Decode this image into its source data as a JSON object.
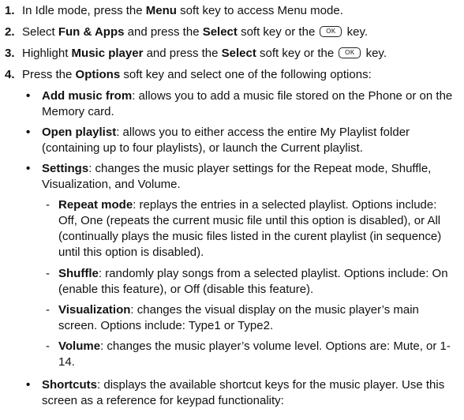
{
  "ok_key_label": "OK",
  "steps": [
    {
      "num": "1.",
      "pre": "In Idle mode, press the ",
      "b1": "Menu",
      "post": " soft key to access Menu mode."
    },
    {
      "num": "2.",
      "pre": "Select ",
      "b1": "Fun & Apps",
      "mid": " and press the ",
      "b2": "Select",
      "post": " soft key or the",
      "end": " key."
    },
    {
      "num": "3.",
      "pre": "Highlight ",
      "b1": "Music player",
      "mid": " and press the ",
      "b2": "Select",
      "post": " soft key or the",
      "end": " key."
    },
    {
      "num": "4.",
      "pre": "Press the ",
      "b1": "Options",
      "post": " soft key and select one of the following options:"
    }
  ],
  "options": [
    {
      "term": "Add music from",
      "desc": ": allows you to add a music file stored on the Phone or on the Memory card."
    },
    {
      "term": "Open playlist",
      "desc": ": allows you to either access the entire My Playlist folder (containing up to four playlists), or launch the Current playlist."
    },
    {
      "term": "Settings",
      "desc": ": changes the music player settings for the Repeat mode, Shuffle, Visualization, and Volume."
    },
    {
      "term": "Shortcuts",
      "desc": ": displays the available shortcut keys for the music player. Use this screen as a reference for keypad functionality:"
    }
  ],
  "settings": [
    {
      "term": "Repeat mode",
      "desc": ": replays the entries in a selected playlist. Options include: Off, One (repeats the current music file until this option is disabled), or All (continually plays the music files listed in the curent playlist (in sequence) until this option is disabled)."
    },
    {
      "term": "Shuffle",
      "desc": ": randomly play songs from a selected playlist. Options include: On (enable this feature), or Off (disable this feature)."
    },
    {
      "term": "Visualization",
      "desc": ": changes the visual display on the music player’s main screen. Options include: Type1 or Type2."
    },
    {
      "term": "Volume",
      "desc": ": changes the music player’s volume level. Options are: Mute, or 1-14."
    }
  ]
}
